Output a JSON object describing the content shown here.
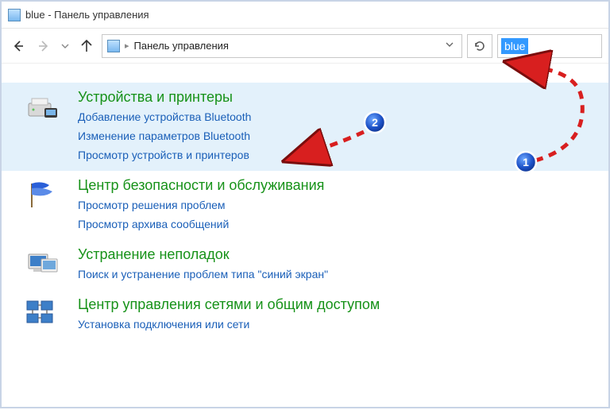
{
  "title": "blue - Панель управления",
  "breadcrumb": {
    "root": "Панель управления"
  },
  "search": {
    "value": "blue"
  },
  "results": [
    {
      "heading": "Устройства и принтеры",
      "links": [
        "Добавление устройства Bluetooth",
        "Изменение параметров Bluetooth",
        "Просмотр устройств и принтеров"
      ],
      "selected": true,
      "icon": "devices-printers"
    },
    {
      "heading": "Центр безопасности и обслуживания",
      "links": [
        "Просмотр решения проблем",
        "Просмотр архива сообщений"
      ],
      "selected": false,
      "icon": "security-flag"
    },
    {
      "heading": "Устранение неполадок",
      "links": [
        "Поиск и устранение проблем типа \"синий экран\""
      ],
      "selected": false,
      "icon": "troubleshoot"
    },
    {
      "heading": "Центр управления сетями и общим доступом",
      "links": [
        "Установка подключения или сети"
      ],
      "selected": false,
      "icon": "network-sharing"
    }
  ],
  "annotations": {
    "badge1": "1",
    "badge2": "2"
  }
}
